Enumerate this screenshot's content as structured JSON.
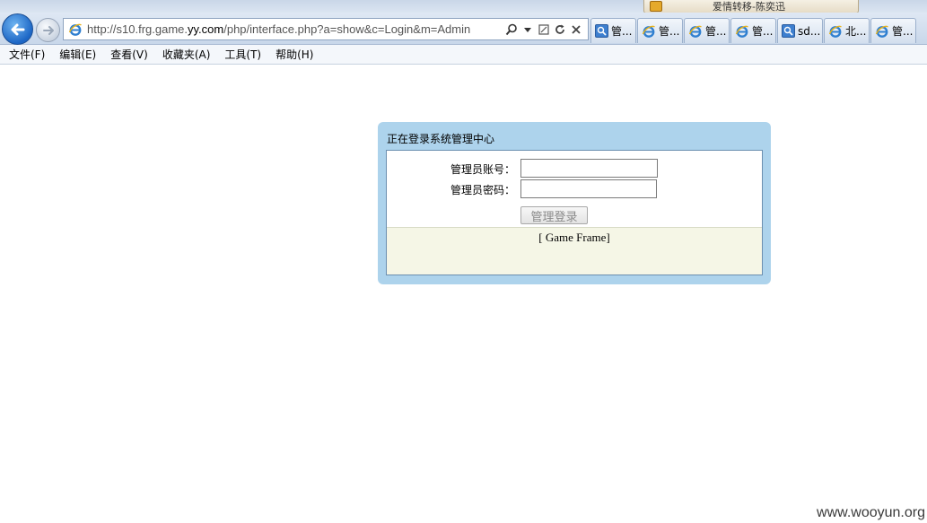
{
  "browser": {
    "address": {
      "url_prefix": "http://s10.frg.game.",
      "url_host": "yy.com",
      "url_path": "/php/interface.php?a=show&c=Login&m=Admin"
    },
    "tabs": [
      {
        "label": "管...",
        "icon": "search-icon"
      },
      {
        "label": "管...",
        "icon": "ie-icon"
      },
      {
        "label": "管...",
        "icon": "ie-icon"
      },
      {
        "label": "管...",
        "icon": "ie-icon"
      },
      {
        "label": "sd...",
        "icon": "search-icon"
      },
      {
        "label": "北...",
        "icon": "ie-icon"
      },
      {
        "label": "管...",
        "icon": "ie-icon"
      }
    ],
    "song_widget": {
      "title": "爱情转移-陈奕迅"
    }
  },
  "menu": {
    "items": [
      "文件(F)",
      "编辑(E)",
      "查看(V)",
      "收藏夹(A)",
      "工具(T)",
      "帮助(H)"
    ]
  },
  "login": {
    "title": "正在登录系统管理中心",
    "account_label": "管理员账号：",
    "password_label": "管理员密码：",
    "account_value": "",
    "password_value": "",
    "submit_label": "管理登录",
    "frame_label": "[ Game Frame]"
  },
  "watermark": "www.wooyun.org",
  "colors": {
    "login_border": "#add3ec",
    "frame_bg": "#f5f6e6",
    "back_button": "#1c66c5"
  }
}
